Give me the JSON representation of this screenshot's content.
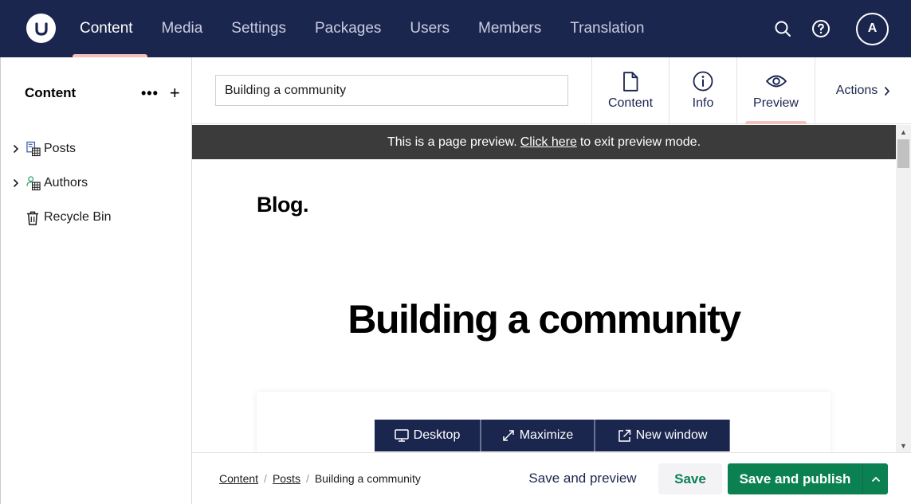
{
  "topbar": {
    "logo_label": "U",
    "nav": [
      "Content",
      "Media",
      "Settings",
      "Packages",
      "Users",
      "Members",
      "Translation"
    ],
    "active_nav": "Content",
    "avatar_initial": "A",
    "icons": [
      "search-icon",
      "help-icon"
    ]
  },
  "sidebar": {
    "title": "Content",
    "more_label": "•••",
    "add_label": "+",
    "items": [
      {
        "label": "Posts",
        "icon": "document-grid-icon",
        "expandable": true
      },
      {
        "label": "Authors",
        "icon": "user-grid-icon",
        "expandable": true
      },
      {
        "label": "Recycle Bin",
        "icon": "trash-icon",
        "expandable": false
      }
    ]
  },
  "editor": {
    "name_value": "Building a community",
    "tabs": [
      {
        "label": "Content",
        "icon": "document-icon"
      },
      {
        "label": "Info",
        "icon": "info-icon"
      },
      {
        "label": "Preview",
        "icon": "eye-icon"
      }
    ],
    "active_tab": "Preview",
    "actions_label": "Actions"
  },
  "preview": {
    "banner_prefix": "This is a page preview.",
    "banner_link": "Click here",
    "banner_suffix": "to exit preview mode.",
    "blog_title": "Blog.",
    "post_title": "Building a community",
    "devices": [
      "Desktop",
      "Maximize",
      "New window"
    ]
  },
  "footer": {
    "breadcrumb": [
      "Content",
      "Posts",
      "Building a community"
    ],
    "save_preview_label": "Save and preview",
    "save_label": "Save",
    "publish_label": "Save and publish"
  },
  "colors": {
    "header_bg": "#1b264f",
    "active_indicator": "#f5c1bc",
    "publish_green": "#0b8152",
    "preview_banner": "#3b3b3b"
  }
}
